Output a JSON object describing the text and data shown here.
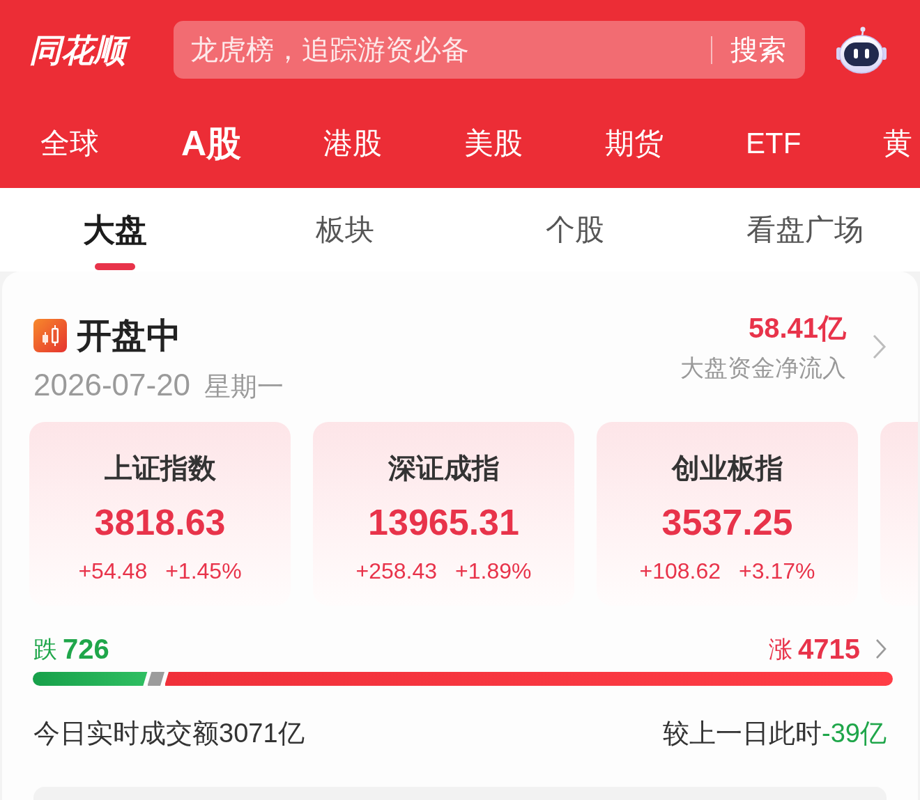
{
  "header": {
    "logo": "同花顺",
    "search": {
      "placeholder": "龙虎榜，追踪游资必备",
      "button": "搜索"
    }
  },
  "market_tabs": [
    {
      "label": "全球",
      "selected": false
    },
    {
      "label": "A股",
      "selected": true
    },
    {
      "label": "港股",
      "selected": false
    },
    {
      "label": "美股",
      "selected": false
    },
    {
      "label": "期货",
      "selected": false
    },
    {
      "label": "ETF",
      "selected": false
    },
    {
      "label": "黄",
      "selected": false
    }
  ],
  "sub_tabs": [
    {
      "label": "大盘",
      "selected": true
    },
    {
      "label": "板块",
      "selected": false
    },
    {
      "label": "个股",
      "selected": false
    },
    {
      "label": "看盘广场",
      "selected": false
    }
  ],
  "market_status": {
    "label": "开盘中",
    "date": "2026-07-20",
    "weekday": "星期一",
    "net_inflow": {
      "value": "58.41亿",
      "rising": true,
      "label": "大盘资金净流入"
    }
  },
  "index_cards": [
    {
      "name": "上证指数",
      "value": "3818.63",
      "change": "+54.48",
      "change_percent": "+1.45%",
      "rising": true
    },
    {
      "name": "深证成指",
      "value": "13965.31",
      "change": "+258.43",
      "change_percent": "+1.89%",
      "rising": true
    },
    {
      "name": "创业板指",
      "value": "3537.25",
      "change": "+108.62",
      "change_percent": "+3.17%",
      "rising": true
    }
  ],
  "breadth": {
    "down": {
      "label": "跌",
      "count": "726"
    },
    "up": {
      "label": "涨",
      "count": "4715"
    },
    "segments": [
      {
        "kind": "down",
        "level": 0.134
      },
      {
        "kind": "flat",
        "level": 0.02
      },
      {
        "kind": "up",
        "level": 0.846
      }
    ]
  },
  "turnover": {
    "label": "今日实时成交额3071亿",
    "compare_label": "较上一日此时",
    "compare_value": "-39亿",
    "compare_rising": false
  }
}
